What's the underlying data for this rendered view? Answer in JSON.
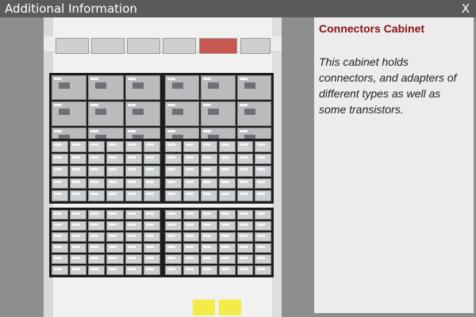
{
  "window": {
    "title": "Additional Information",
    "close_label": "X"
  },
  "info": {
    "heading": "Connectors Cabinet",
    "description": "This cabinet holds connectors, and adapters of different types as well as some transistors."
  }
}
